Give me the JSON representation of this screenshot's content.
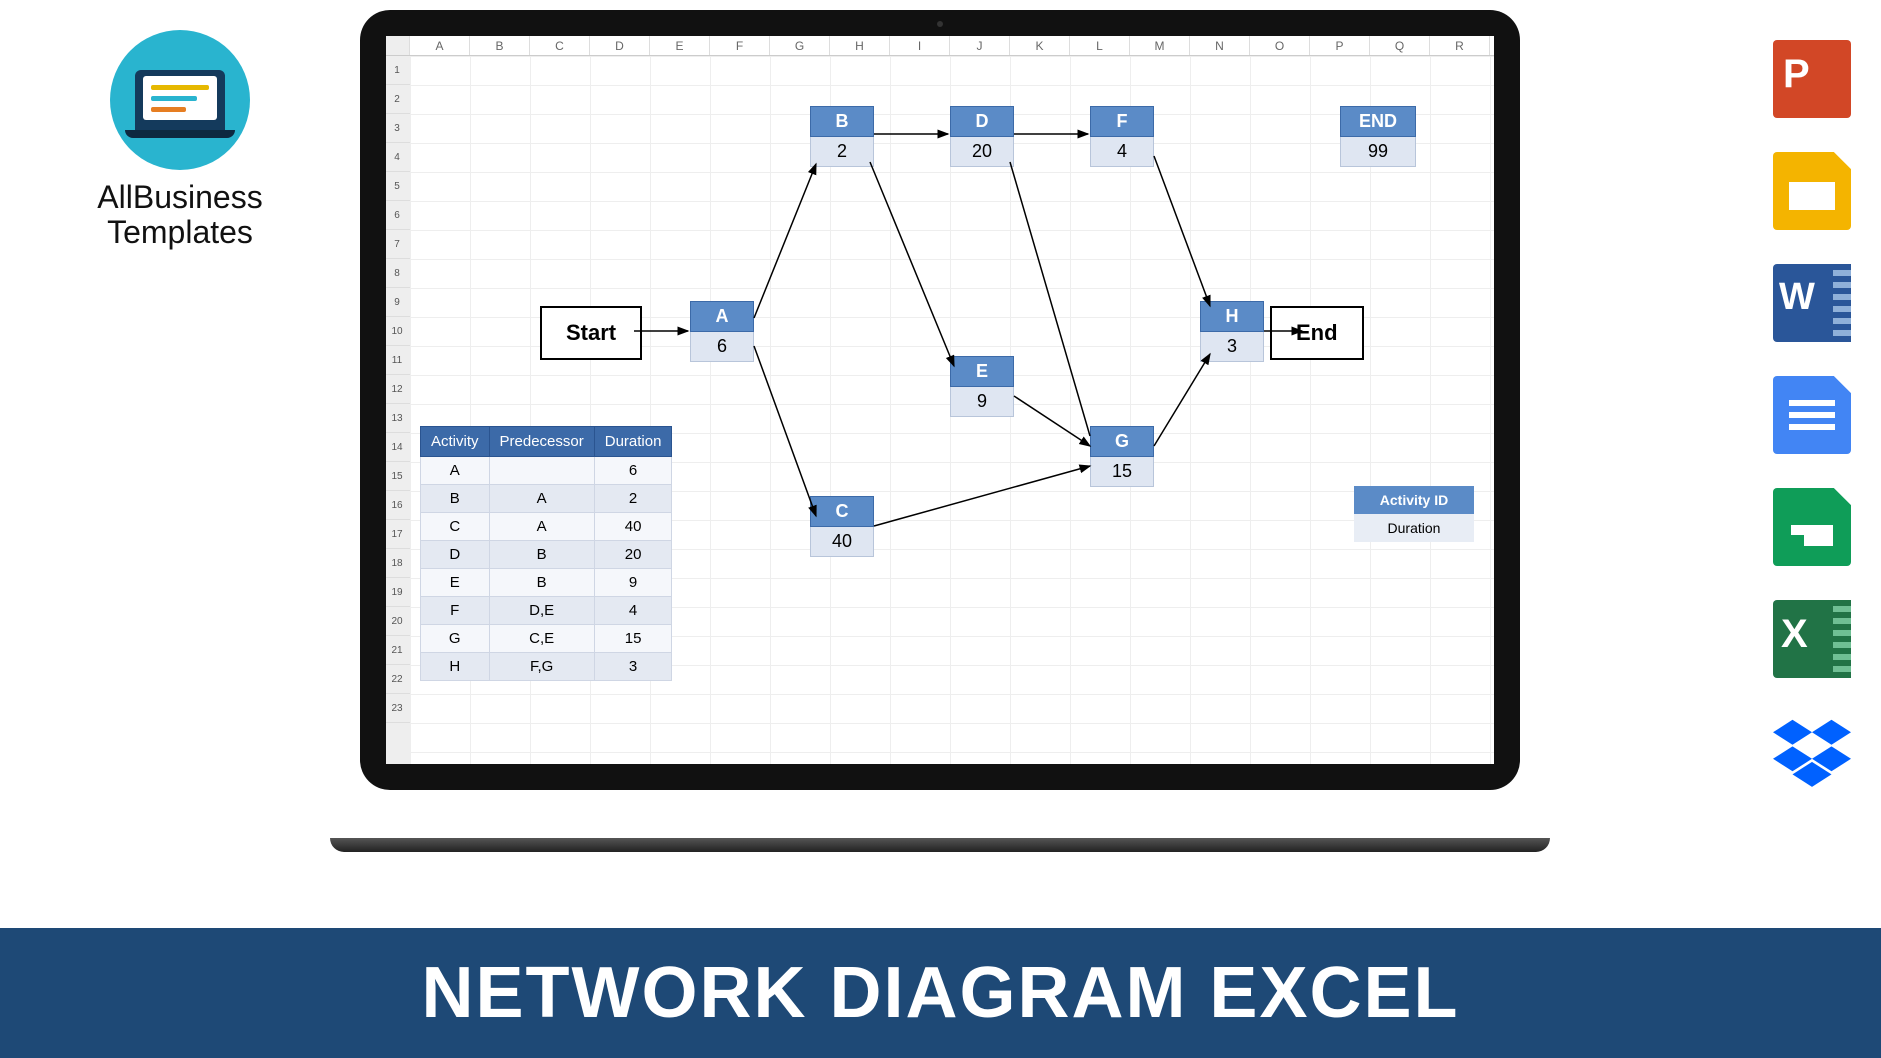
{
  "brand": {
    "line1": "AllBusiness",
    "line2": "Templates"
  },
  "banner_title": "NETWORK DIAGRAM EXCEL",
  "columns": [
    "A",
    "B",
    "C",
    "D",
    "E",
    "F",
    "G",
    "H",
    "I",
    "J",
    "K",
    "L",
    "M",
    "N",
    "O",
    "P",
    "Q",
    "R"
  ],
  "rows": [
    "1",
    "2",
    "3",
    "4",
    "5",
    "6",
    "7",
    "8",
    "9",
    "10",
    "11",
    "12",
    "13",
    "14",
    "15",
    "16",
    "17",
    "18",
    "19",
    "20",
    "21",
    "22",
    "23"
  ],
  "table": {
    "headers": [
      "Activity",
      "Predecessor",
      "Duration"
    ],
    "rows": [
      [
        "A",
        "",
        "6"
      ],
      [
        "B",
        "A",
        "2"
      ],
      [
        "C",
        "A",
        "40"
      ],
      [
        "D",
        "B",
        "20"
      ],
      [
        "E",
        "B",
        "9"
      ],
      [
        "F",
        "D,E",
        "4"
      ],
      [
        "G",
        "C,E",
        "15"
      ],
      [
        "H",
        "F,G",
        "3"
      ]
    ]
  },
  "start_label": "Start",
  "end_label": "End",
  "nodes": {
    "A": {
      "id": "A",
      "dur": "6"
    },
    "B": {
      "id": "B",
      "dur": "2"
    },
    "C": {
      "id": "C",
      "dur": "40"
    },
    "D": {
      "id": "D",
      "dur": "20"
    },
    "E": {
      "id": "E",
      "dur": "9"
    },
    "F": {
      "id": "F",
      "dur": "4"
    },
    "G": {
      "id": "G",
      "dur": "15"
    },
    "H": {
      "id": "H",
      "dur": "3"
    },
    "END": {
      "id": "END",
      "dur": "99"
    }
  },
  "legend": {
    "header": "Activity ID",
    "value": "Duration"
  },
  "side_apps": [
    "powerpoint",
    "google-slides",
    "word",
    "google-docs",
    "google-sheets",
    "excel",
    "dropbox"
  ]
}
